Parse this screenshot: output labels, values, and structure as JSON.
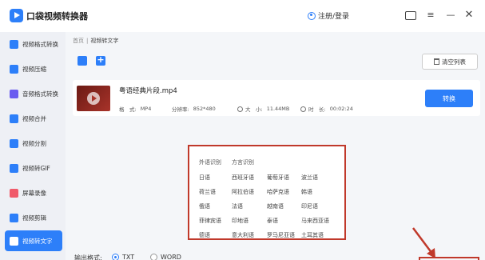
{
  "app": {
    "title": "口袋视频转换器",
    "login_label": "注册/登录"
  },
  "sidebar": {
    "items": [
      {
        "label": "视频格式转换",
        "color": "blue"
      },
      {
        "label": "视频压缩",
        "color": "blue"
      },
      {
        "label": "音频格式转换",
        "color": "purple"
      },
      {
        "label": "视频合并",
        "color": "blue"
      },
      {
        "label": "视频分割",
        "color": "blue"
      },
      {
        "label": "视频转GIF",
        "color": "blue"
      },
      {
        "label": "屏幕录像",
        "color": "red"
      },
      {
        "label": "视频剪辑",
        "color": "blue"
      },
      {
        "label": "视频转文字",
        "color": "white",
        "active": true
      }
    ]
  },
  "breadcrumb": {
    "home": "首页",
    "separator": "|",
    "current": "视频转文字"
  },
  "toolbar": {
    "clear_label": "清空列表"
  },
  "file": {
    "name": "粤语经典片段.mp4",
    "format_label": "格　式:",
    "format_value": "MP4",
    "resolution_label": "分辨率:",
    "resolution_value": "852*480",
    "size_label": "大　小:",
    "size_value": "11.44MB",
    "duration_label": "时　长:",
    "duration_value": "00:02:24",
    "convert_label": "转换"
  },
  "languages": {
    "tabs": [
      "外语识别",
      "方言识别"
    ],
    "grid": [
      [
        "日语",
        "西班牙语",
        "葡萄牙语",
        "波兰语"
      ],
      [
        "荷兰语",
        "阿拉伯语",
        "哈萨克语",
        "韩语"
      ],
      [
        "俄语",
        "法语",
        "越南语",
        "印尼语"
      ],
      [
        "菲律宾语",
        "印地语",
        "泰语",
        "马来西亚语"
      ],
      [
        "德语",
        "意大利语",
        "罗马尼亚语",
        "土耳其语"
      ]
    ]
  },
  "output": {
    "label": "输出格式:",
    "options": [
      {
        "label": "TXT",
        "selected": true
      },
      {
        "label": "WORD",
        "selected": false
      }
    ]
  },
  "colors": {
    "accent": "#2d7ff9",
    "highlight": "#c0392b",
    "sidebar_bg": "#eef0f5"
  }
}
